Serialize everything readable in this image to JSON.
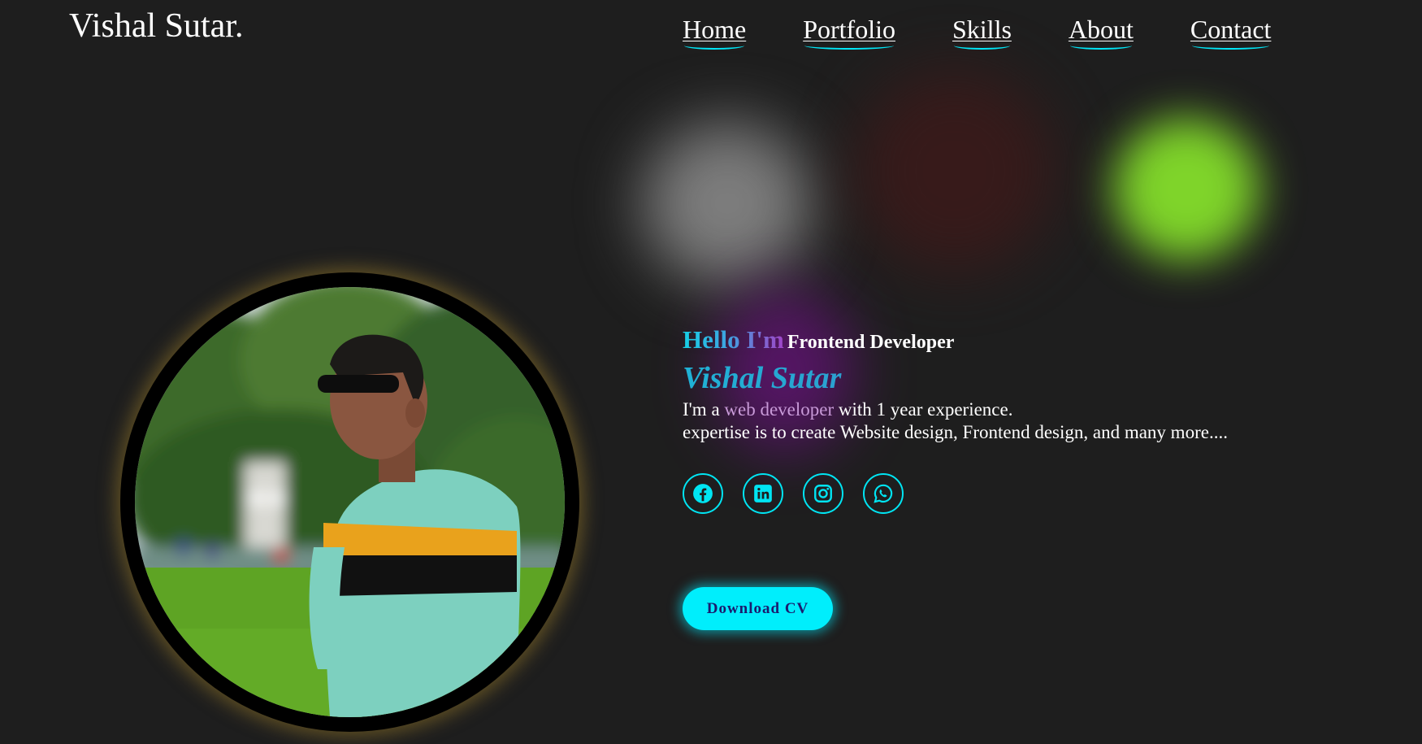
{
  "header": {
    "brand": "Vishal Sutar.",
    "nav": [
      {
        "label": "Home"
      },
      {
        "label": "Portfolio"
      },
      {
        "label": "Skills"
      },
      {
        "label": "About"
      },
      {
        "label": "Contact"
      }
    ]
  },
  "hero": {
    "greeting": "Hello I'm",
    "role": "Frontend Developer",
    "name": "Vishal Sutar",
    "intro_prefix": "I'm a ",
    "intro_highlight": "web developer",
    "intro_suffix": " with 1 year experience.",
    "intro_line2": "expertise is to create Website design, Frontend design, and many more....",
    "socials": [
      {
        "icon": "facebook-icon"
      },
      {
        "icon": "linkedin-icon"
      },
      {
        "icon": "instagram-icon"
      },
      {
        "icon": "whatsapp-icon"
      }
    ],
    "cv_button": "Download CV"
  },
  "colors": {
    "background": "#1e1e1e",
    "accent_cyan": "#00eefc",
    "underline": "#00e7f7",
    "highlight": "#c89ad8"
  }
}
